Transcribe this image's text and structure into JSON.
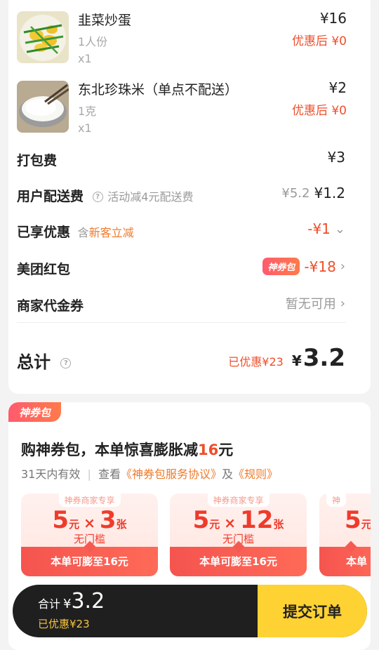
{
  "items": [
    {
      "name": "韭菜炒蛋",
      "spec": "1人份",
      "qty": "x1",
      "price": "¥16",
      "discount": "优惠后 ¥0"
    },
    {
      "name": "东北珍珠米（单点不配送）",
      "spec": "1克",
      "qty": "x1",
      "price": "¥2",
      "discount": "优惠后 ¥0"
    }
  ],
  "fees": {
    "packing_label": "打包费",
    "packing_value": "¥3",
    "delivery_label": "用户配送费",
    "delivery_note": "活动减4元配送费",
    "delivery_original": "¥5.2",
    "delivery_value": "¥1.2",
    "enjoyed_label": "已享优惠",
    "enjoyed_prefix": "含",
    "enjoyed_tag": "新客立减",
    "enjoyed_value": "-¥1",
    "redpack_label": "美团红包",
    "redpack_badge": "神券包",
    "redpack_value": "-¥18",
    "voucher_label": "商家代金券",
    "voucher_value": "暂无可用"
  },
  "total": {
    "label": "总计",
    "saved": "已优惠¥23",
    "yen": "¥",
    "amount": "3.2"
  },
  "package": {
    "badge": "神券包",
    "headline_pre": "购神券包，本单惊喜膨胀减",
    "headline_num": "16",
    "headline_post": "元",
    "validity": "31天内有效",
    "see": "查看",
    "agreement": "《神券包服务协议》",
    "and": "及",
    "rules": "《规则》",
    "coupons": [
      {
        "top": "神券商家专享",
        "value": "5",
        "unit": "元",
        "times": "×",
        "count": "3",
        "count_unit": "张",
        "threshold": "无门槛",
        "bottom": "本单可膨至16元"
      },
      {
        "top": "神券商家专享",
        "value": "5",
        "unit": "元",
        "times": "×",
        "count": "12",
        "count_unit": "张",
        "threshold": "无门槛",
        "bottom": "本单可膨至16元"
      },
      {
        "top": "神",
        "value": "5",
        "unit": "元",
        "bottom": "本单"
      }
    ]
  },
  "bar": {
    "label": "合计",
    "yen": "¥",
    "amount": "3.2",
    "saved": "已优惠¥23",
    "submit": "提交订单"
  }
}
